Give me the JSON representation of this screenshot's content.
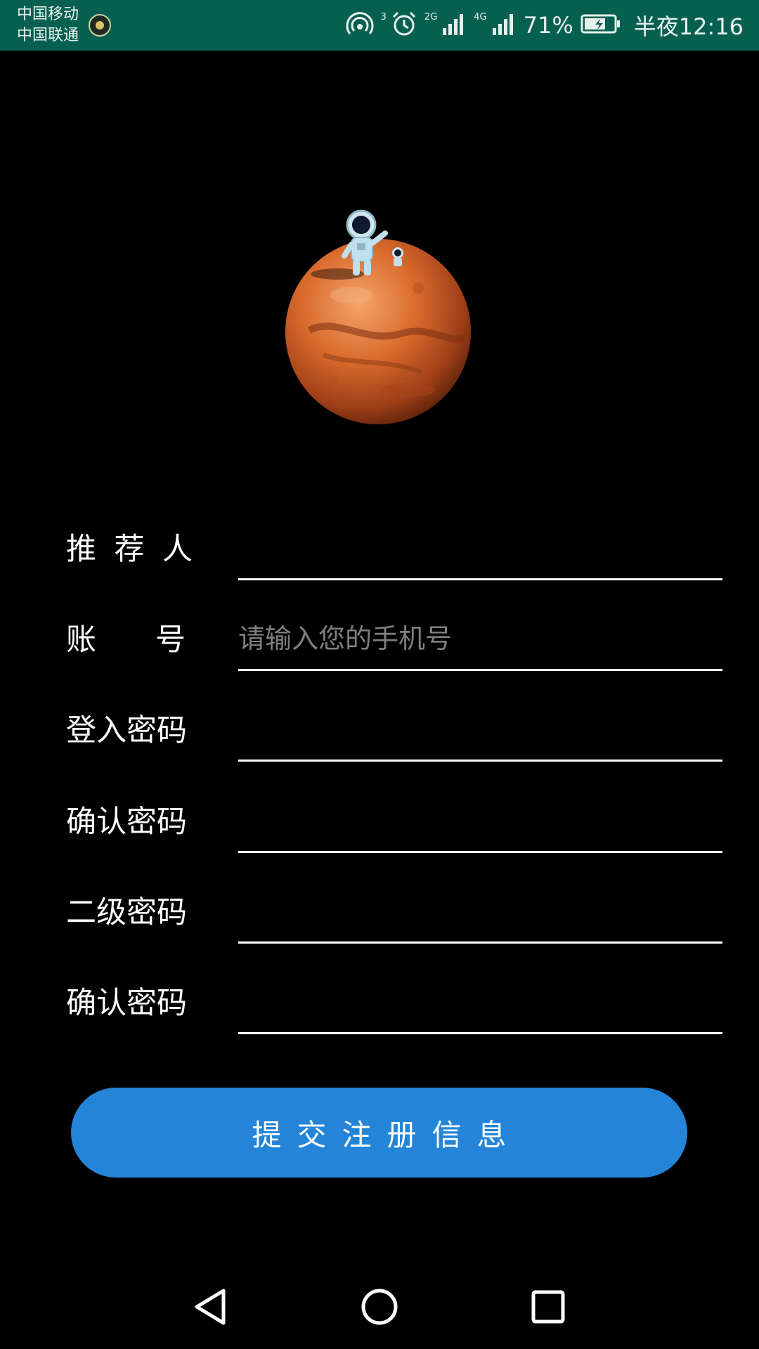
{
  "status_bar": {
    "carrier_1": "中国移动",
    "carrier_2": "中国联通",
    "hotspot_superscript": "3",
    "net_1": "2G",
    "net_2": "4G",
    "battery_percent": "71%",
    "time": "半夜12:16",
    "background_color": "#06604f"
  },
  "form": {
    "referrer_label_chars": [
      "推",
      "荐",
      "人"
    ],
    "account_label_chars": [
      "账",
      "号"
    ],
    "login_password_label": "登入密码",
    "confirm_password_label": "确认密码",
    "secondary_password_label": "二级密码",
    "confirm_secondary_password_label": "确认密码",
    "account_placeholder": "请输入您的手机号",
    "referrer_value": "",
    "login_password_value": "",
    "confirm_password_value": "",
    "secondary_password_value": "",
    "confirm_secondary_password_value": ""
  },
  "submit": {
    "label": "提交注册信息",
    "color": "#2384d8"
  },
  "icons": {
    "hero": "mars-with-astronaut-illustration",
    "nav_back": "triangle-back-icon",
    "nav_home": "circle-home-icon",
    "nav_recent": "square-recent-icon"
  }
}
